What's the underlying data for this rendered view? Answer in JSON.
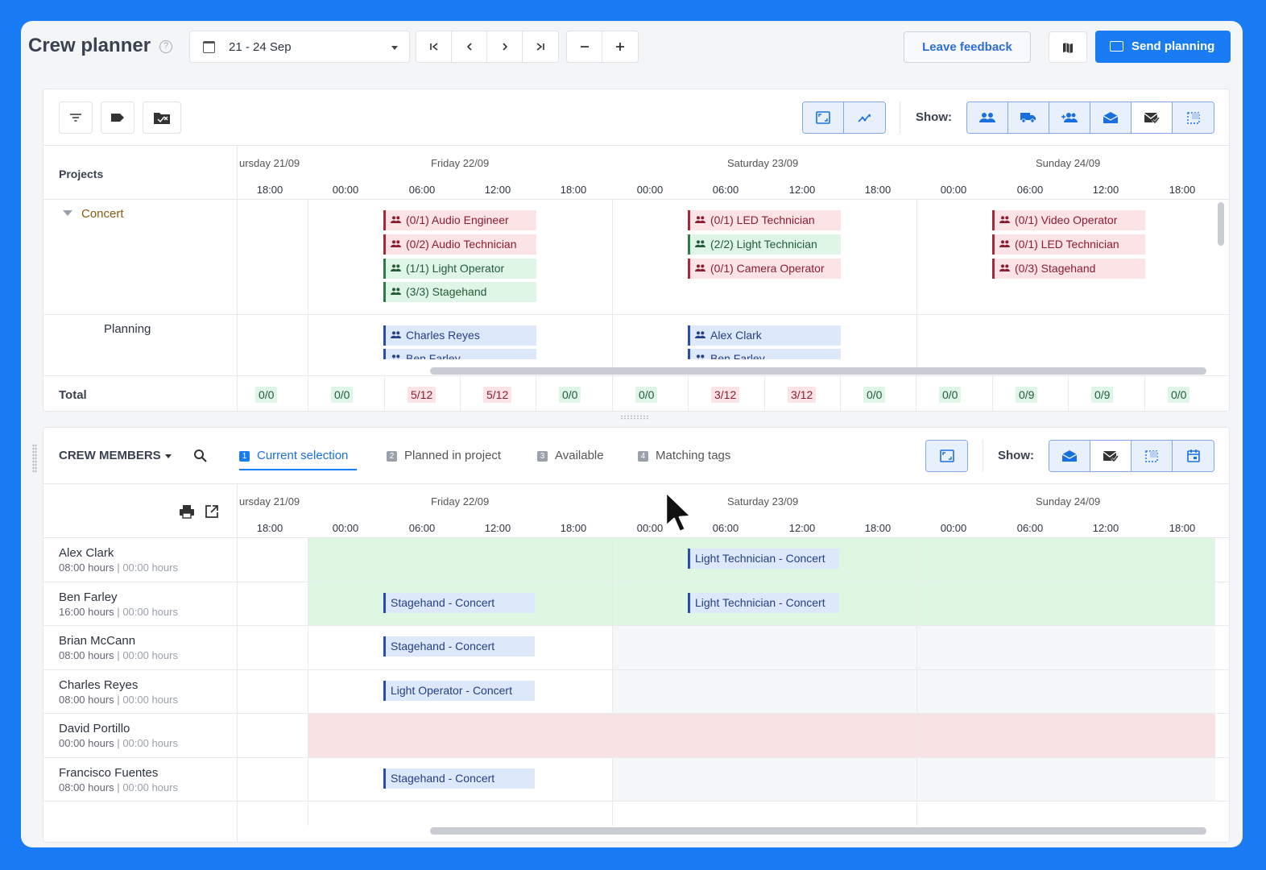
{
  "app": {
    "title": "Crew planner"
  },
  "date_range": "21 - 24 Sep",
  "header": {
    "leave_feedback": "Leave feedback",
    "send_planning": "Send planning"
  },
  "colors": {
    "accent": "#1a7cf5",
    "red": "#a42a3b",
    "green": "#2f7a4a",
    "blue": "#2a4ea6"
  },
  "projects_panel": {
    "show_label": "Show:",
    "column_title": "Projects",
    "days": [
      "ursday 21/09",
      "Friday 22/09",
      "Saturday 23/09",
      "Sunday 24/09"
    ],
    "hours": [
      "18:00",
      "00:00",
      "06:00",
      "12:00",
      "18:00",
      "00:00",
      "06:00",
      "12:00",
      "18:00",
      "00:00",
      "06:00",
      "12:00",
      "18:00"
    ],
    "group": "Concert",
    "sub_row": "Planning",
    "chips": [
      {
        "text": "(0/1) Audio Engineer",
        "color": "red"
      },
      {
        "text": "(0/2) Audio Technician",
        "color": "red"
      },
      {
        "text": "(1/1) Light Operator",
        "color": "green"
      },
      {
        "text": "(3/3) Stagehand",
        "color": "green"
      },
      {
        "text": "(0/1) LED Technician",
        "color": "red"
      },
      {
        "text": "(2/2) Light Technician",
        "color": "green"
      },
      {
        "text": "(0/1) Camera Operator",
        "color": "red"
      },
      {
        "text": "(0/1) Video Operator",
        "color": "red"
      },
      {
        "text": "(0/1) LED Technician",
        "color": "red"
      },
      {
        "text": "(0/3) Stagehand",
        "color": "red"
      }
    ],
    "planning_chips": [
      "Charles Reyes",
      "Ben Farley",
      "Alex Clark",
      "Ben Farley"
    ],
    "total_label": "Total",
    "totals": [
      "0/0",
      "0/0",
      "5/12",
      "5/12",
      "0/0",
      "0/0",
      "3/12",
      "3/12",
      "0/0",
      "0/0",
      "0/9",
      "0/9",
      "0/0"
    ]
  },
  "crew_panel": {
    "title": "CREW MEMBERS",
    "show_label": "Show:",
    "tabs": [
      {
        "num": "1",
        "label": "Current selection"
      },
      {
        "num": "2",
        "label": "Planned in project"
      },
      {
        "num": "3",
        "label": "Available"
      },
      {
        "num": "4",
        "label": "Matching tags"
      }
    ],
    "members": [
      {
        "name": "Alex Clark",
        "hours": "08:00 hours",
        "hours2": "00:00 hours"
      },
      {
        "name": "Ben Farley",
        "hours": "16:00 hours",
        "hours2": "00:00 hours"
      },
      {
        "name": "Brian McCann",
        "hours": "08:00 hours",
        "hours2": "00:00 hours"
      },
      {
        "name": "Charles Reyes",
        "hours": "08:00 hours",
        "hours2": "00:00 hours"
      },
      {
        "name": "David Portillo",
        "hours": "00:00 hours",
        "hours2": "00:00 hours"
      },
      {
        "name": "Francisco Fuentes",
        "hours": "08:00 hours",
        "hours2": "00:00 hours"
      }
    ],
    "assignments": [
      "Light Technician - Concert",
      "Stagehand - Concert",
      "Light Technician - Concert",
      "Stagehand - Concert",
      "Light Operator - Concert",
      "Stagehand - Concert"
    ],
    "separator": "|"
  }
}
